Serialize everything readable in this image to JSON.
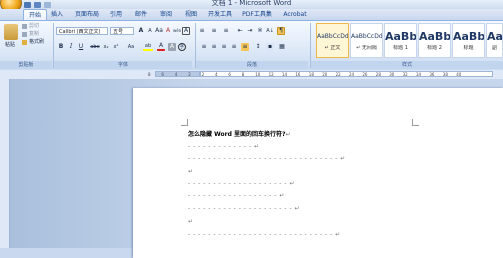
{
  "window": {
    "title": "文档 1 - Microsoft Word"
  },
  "tabs": [
    {
      "label": "开始",
      "active": true
    },
    {
      "label": "插入",
      "active": false
    },
    {
      "label": "页面布局",
      "active": false
    },
    {
      "label": "引用",
      "active": false
    },
    {
      "label": "邮件",
      "active": false
    },
    {
      "label": "审阅",
      "active": false
    },
    {
      "label": "视图",
      "active": false
    },
    {
      "label": "开发工具",
      "active": false
    },
    {
      "label": "PDF工具集",
      "active": false
    },
    {
      "label": "Acrobat",
      "active": false
    }
  ],
  "clipboard": {
    "paste_label": "粘贴",
    "cut_label": "剪切",
    "copy_label": "复制",
    "format_painter_label": "格式刷",
    "group_label": "剪贴板"
  },
  "font": {
    "font_name": "Calibri (西文正文)",
    "font_size": "五号",
    "bold": "B",
    "italic": "I",
    "underline": "U",
    "strike": "abe",
    "subscript": "x₂",
    "superscript": "x²",
    "case": "Aa",
    "grow": "A",
    "shrink": "A",
    "clear": "A",
    "phonetic": "wén",
    "char_border": "A",
    "highlight": "ab",
    "font_color": "A",
    "char_shade": "A",
    "enclosed": "字",
    "group_label": "字体"
  },
  "paragraph": {
    "sort_label": "A↓",
    "show_marks": "¶",
    "group_label": "段落"
  },
  "styles": {
    "items": [
      {
        "sample": "AaBbCcDd",
        "name": "↵ 正文",
        "big": false,
        "selected": true
      },
      {
        "sample": "AaBbCcDd",
        "name": "↵ 无间隔",
        "big": false,
        "selected": false
      },
      {
        "sample": "AaBb",
        "name": "标题 1",
        "big": true,
        "selected": false
      },
      {
        "sample": "AaBbC",
        "name": "标题 2",
        "big": true,
        "selected": false
      },
      {
        "sample": "AaBbC",
        "name": "标题",
        "big": true,
        "selected": false
      },
      {
        "sample": "AaB",
        "name": "副",
        "big": true,
        "selected": false
      }
    ],
    "group_label": "样式"
  },
  "ruler": {
    "ticks": [
      "8",
      "6",
      "4",
      "2",
      "2",
      "4",
      "6",
      "8",
      "10",
      "12",
      "14",
      "16",
      "18",
      "20",
      "22",
      "24",
      "26",
      "28",
      "30",
      "32",
      "34",
      "36",
      "38",
      "40"
    ]
  },
  "document": {
    "heading": "怎么隐藏 Word 里面的回车换行符?",
    "para_mark": "↵",
    "lines": [
      "- - - - - - - - - - - - - ↵",
      "- - - - - - - - - - - - - - - - - - - - - - - - - - - - - - ↵",
      "↵",
      "- - - - - - - - - - - - - - - - - - - - ↵",
      "- - - - - - - - - - - - - - - - - - ↵",
      "- - - - - - - - - - - - - - - - - - - - - ↵",
      "↵",
      "- - - - - - - - - - - - - - - - - - - - - - - - - - - - - ↵"
    ]
  },
  "colors": {
    "highlight": "#ffff00",
    "font_color": "#e02020",
    "char_shade": "#9aa4b0"
  }
}
